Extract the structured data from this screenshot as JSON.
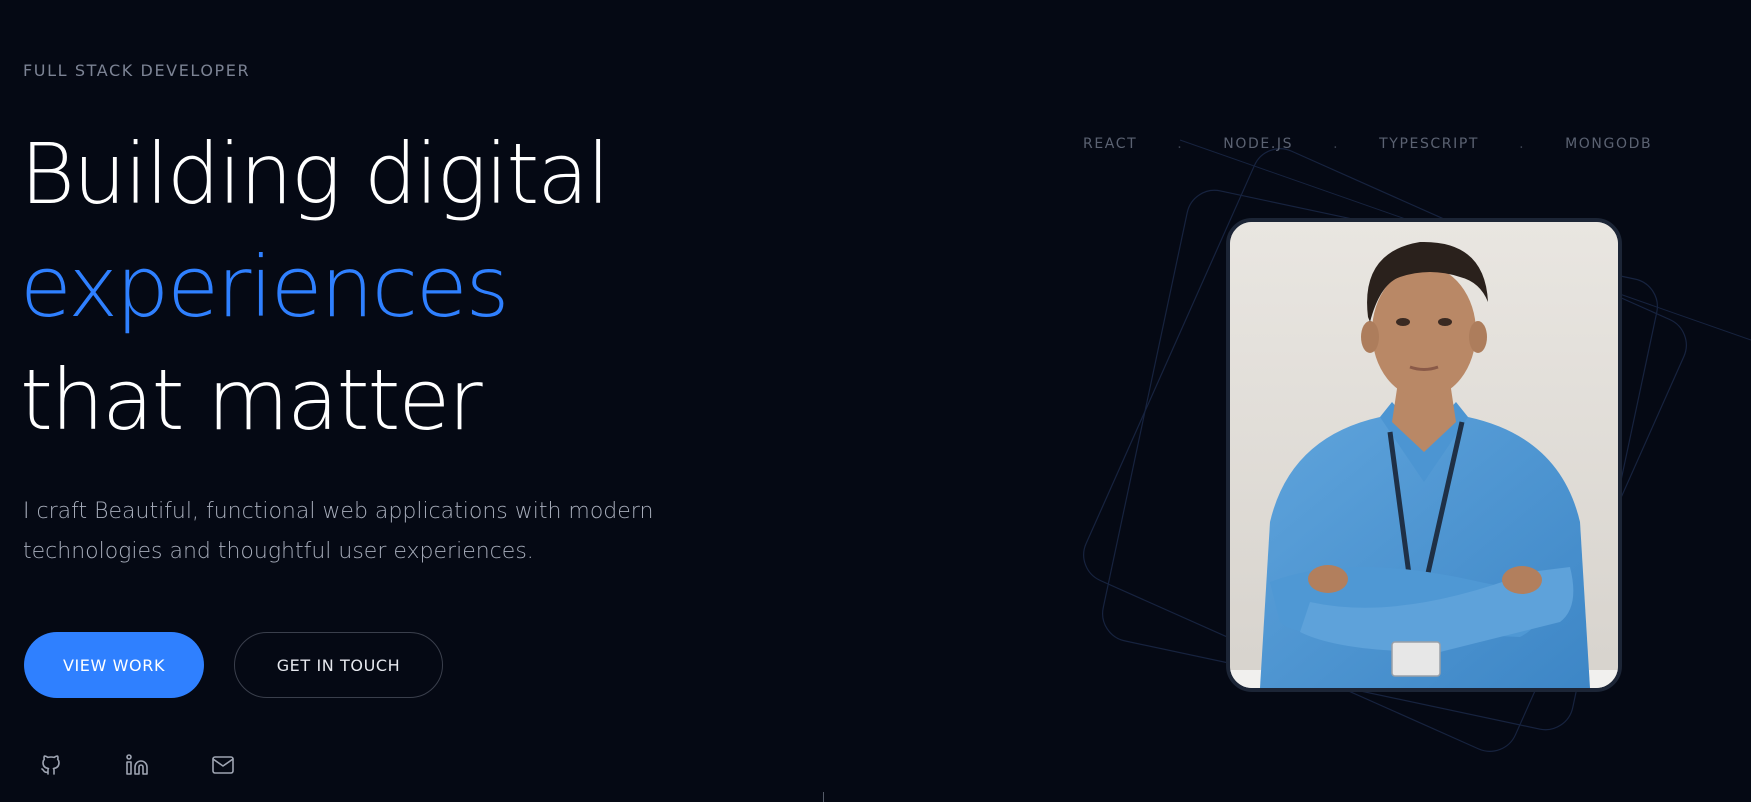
{
  "hero": {
    "eyebrow": "FULL STACK DEVELOPER",
    "headline_line1": "Building digital",
    "headline_line2": "experiences",
    "headline_line3": "that matter",
    "subtitle": "I craft Beautiful, functional web applications with modern technologies and thoughtful user experiences.",
    "primary_button": "VIEW WORK",
    "secondary_button": "GET IN TOUCH"
  },
  "tech_stack": [
    "REACT",
    "NODE.JS",
    "TYPESCRIPT",
    "MONGODB"
  ],
  "tech_separator": ".",
  "socials": [
    {
      "name": "github",
      "icon": "github-icon"
    },
    {
      "name": "linkedin",
      "icon": "linkedin-icon"
    },
    {
      "name": "email",
      "icon": "mail-icon"
    }
  ],
  "colors": {
    "background": "#050914",
    "accent": "#2f80ff",
    "text": "#ffffff",
    "muted": "#a7adbb"
  },
  "portrait": {
    "icon": "portrait-photo"
  }
}
